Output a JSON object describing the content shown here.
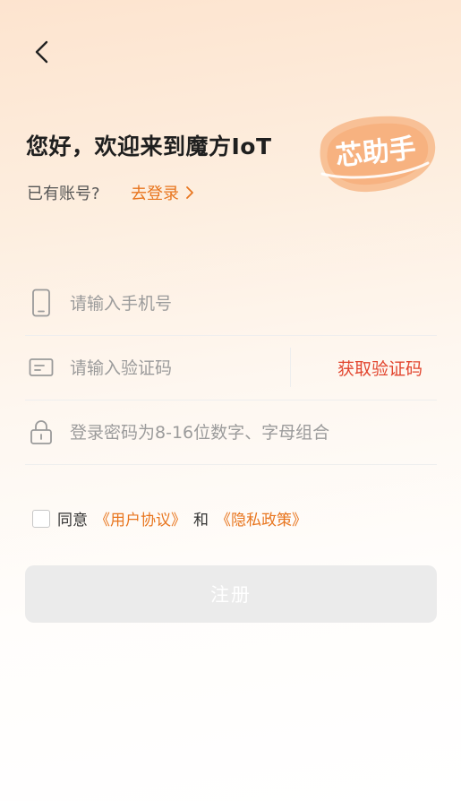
{
  "header": {
    "title": "您好，欢迎来到魔方IoT",
    "badge_text": "芯助手",
    "subtitle": "已有账号?",
    "login_link": "去登录"
  },
  "form": {
    "phone_placeholder": "请输入手机号",
    "code_placeholder": "请输入验证码",
    "get_code_label": "获取验证码",
    "password_placeholder": "登录密码为8-16位数字、字母组合"
  },
  "agreement": {
    "agree_label": "同意",
    "user_agreement": "《用户协议》",
    "and_label": "和",
    "privacy_policy": "《隐私政策》",
    "checked": false
  },
  "submit_label": "注册",
  "colors": {
    "accent": "#e8751e",
    "code_button": "#e2462f",
    "button_disabled": "#ebebeb"
  }
}
